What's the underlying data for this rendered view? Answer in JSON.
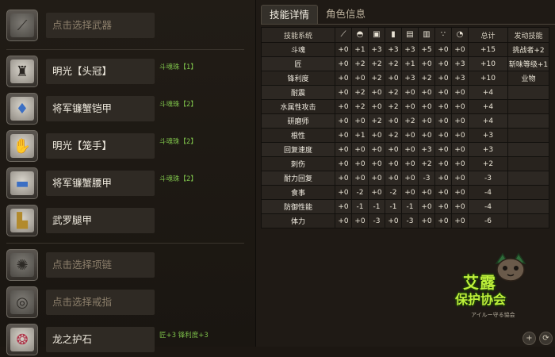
{
  "equipment": {
    "weapon": {
      "label": "点击选择武器",
      "icon": "weapon-empty-icon"
    },
    "head": {
      "label": "明光【头冠】",
      "note": "斗魂珠【1】",
      "icon": "helmet-icon"
    },
    "chest": {
      "label": "将军镰蟹铠甲",
      "note": "斗魂珠【2】",
      "icon": "chest-armor-icon"
    },
    "arms": {
      "label": "明光【笼手】",
      "note": "斗魂珠【2】",
      "icon": "gauntlet-icon"
    },
    "waist": {
      "label": "将军镰蟹腰甲",
      "note": "斗魂珠【2】",
      "icon": "waist-armor-icon"
    },
    "legs": {
      "label": "武罗腿甲",
      "icon": "leg-armor-icon"
    },
    "necklace": {
      "label": "点击选择项链",
      "icon": "necklace-empty-icon"
    },
    "ring": {
      "label": "点击选择戒指",
      "icon": "ring-empty-icon"
    },
    "charm": {
      "label": "龙之护石",
      "note": "匠+3 锋利度+3",
      "icon": "charm-icon"
    }
  },
  "tabs": [
    {
      "label": "技能详情",
      "active": true
    },
    {
      "label": "角色信息",
      "active": false
    }
  ],
  "table": {
    "headers": {
      "system": "技能系统",
      "total": "总计",
      "activated": "发动技能"
    },
    "slot_icons": [
      "weapon-icon",
      "helmet-icon",
      "chest-icon",
      "arms-icon",
      "waist-icon",
      "legs-icon",
      "necklace-icon",
      "ring-icon"
    ],
    "rows": [
      {
        "name": "斗魂",
        "vals": [
          "+0",
          "+1",
          "+3",
          "+3",
          "+3",
          "+5",
          "+0",
          "+0"
        ],
        "total": "+15",
        "skill": "挑战者+2"
      },
      {
        "name": "匠",
        "vals": [
          "+0",
          "+2",
          "+2",
          "+2",
          "+1",
          "+0",
          "+0",
          "+3"
        ],
        "total": "+10",
        "skill": "斩味等级+1"
      },
      {
        "name": "锋利度",
        "vals": [
          "+0",
          "+0",
          "+2",
          "+0",
          "+3",
          "+2",
          "+0",
          "+3"
        ],
        "total": "+10",
        "skill": "业物"
      },
      {
        "name": "耐震",
        "vals": [
          "+0",
          "+2",
          "+0",
          "+2",
          "+0",
          "+0",
          "+0",
          "+0"
        ],
        "total": "+4",
        "skill": ""
      },
      {
        "name": "水属性攻击",
        "vals": [
          "+0",
          "+2",
          "+0",
          "+2",
          "+0",
          "+0",
          "+0",
          "+0"
        ],
        "total": "+4",
        "skill": ""
      },
      {
        "name": "研磨师",
        "vals": [
          "+0",
          "+0",
          "+2",
          "+0",
          "+2",
          "+0",
          "+0",
          "+0"
        ],
        "total": "+4",
        "skill": ""
      },
      {
        "name": "根性",
        "vals": [
          "+0",
          "+1",
          "+0",
          "+2",
          "+0",
          "+0",
          "+0",
          "+0"
        ],
        "total": "+3",
        "skill": ""
      },
      {
        "name": "回复速度",
        "vals": [
          "+0",
          "+0",
          "+0",
          "+0",
          "+0",
          "+3",
          "+0",
          "+0"
        ],
        "total": "+3",
        "skill": ""
      },
      {
        "name": "刺伤",
        "vals": [
          "+0",
          "+0",
          "+0",
          "+0",
          "+0",
          "+2",
          "+0",
          "+0"
        ],
        "total": "+2",
        "skill": ""
      },
      {
        "name": "耐力回复",
        "vals": [
          "+0",
          "+0",
          "+0",
          "+0",
          "+0",
          "-3",
          "+0",
          "+0"
        ],
        "total": "-3",
        "skill": ""
      },
      {
        "name": "食事",
        "vals": [
          "+0",
          "-2",
          "+0",
          "-2",
          "+0",
          "+0",
          "+0",
          "+0"
        ],
        "total": "-4",
        "skill": ""
      },
      {
        "name": "防御性能",
        "vals": [
          "+0",
          "-1",
          "-1",
          "-1",
          "-1",
          "+0",
          "+0",
          "+0"
        ],
        "total": "-4",
        "skill": ""
      },
      {
        "name": "体力",
        "vals": [
          "+0",
          "+0",
          "-3",
          "+0",
          "-3",
          "+0",
          "+0",
          "+0"
        ],
        "total": "-6",
        "skill": ""
      }
    ]
  },
  "logo": {
    "title": "艾露",
    "subtitle": "保护协会",
    "tagline": "アイルー守る協会"
  },
  "corner_buttons": [
    "+",
    "⟳"
  ]
}
